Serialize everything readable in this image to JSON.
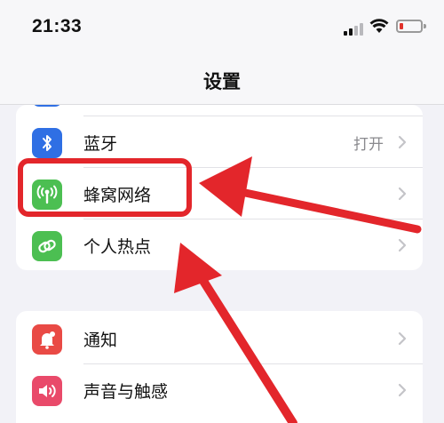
{
  "status_bar": {
    "time": "21:33"
  },
  "nav": {
    "title": "设置"
  },
  "group1": {
    "items": [
      {
        "label": "蓝牙",
        "value": "打开",
        "icon": "bluetooth-icon",
        "color": "#2f6fe4"
      },
      {
        "label": "蜂窝网络",
        "value": "",
        "icon": "antenna-icon",
        "color": "#4cbf52"
      },
      {
        "label": "个人热点",
        "value": "",
        "icon": "hotspot-link-icon",
        "color": "#4cbf52"
      }
    ]
  },
  "group2": {
    "items": [
      {
        "label": "通知",
        "icon": "bell-icon",
        "color": "#e94a45"
      },
      {
        "label": "声音与触感",
        "icon": "speaker-icon",
        "color": "#e94a6a"
      }
    ]
  },
  "annotation": {
    "color": "#e3262b"
  }
}
